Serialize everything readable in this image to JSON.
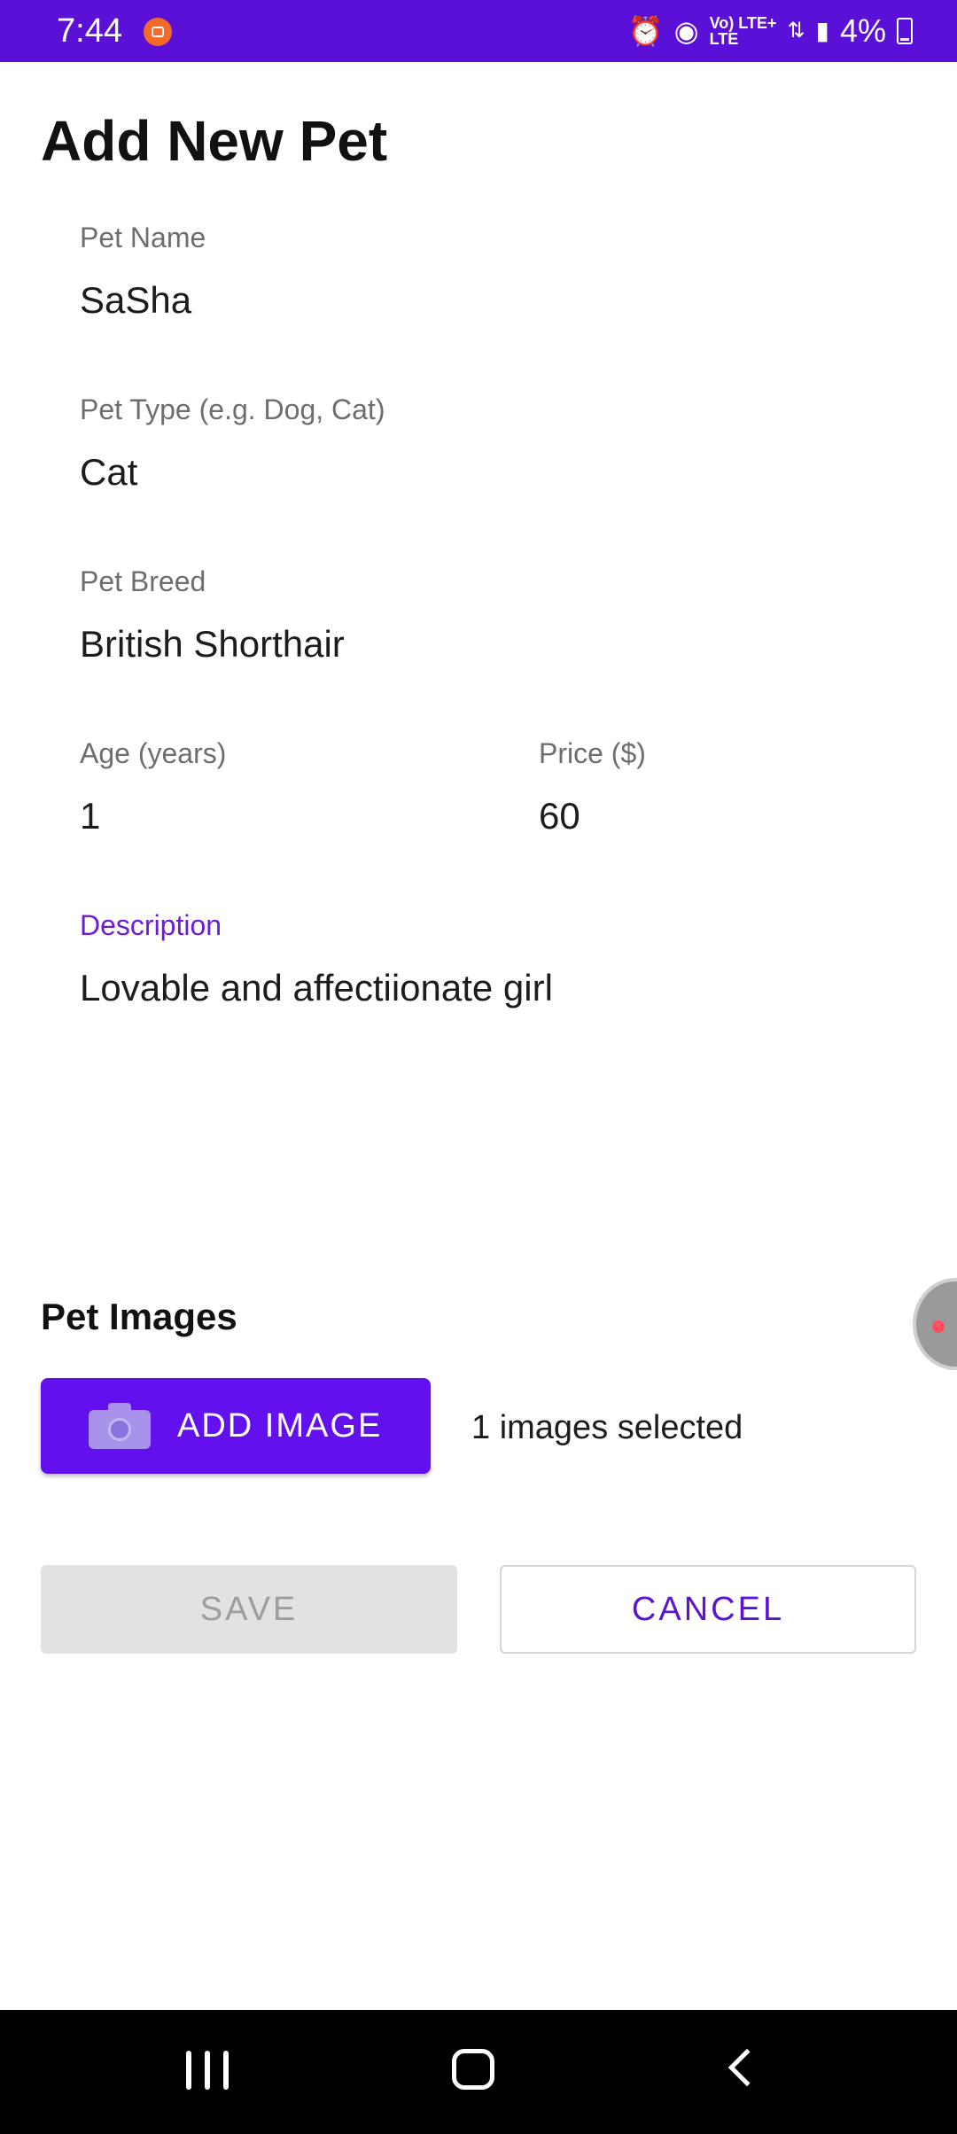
{
  "status_bar": {
    "time": "7:44",
    "network_label": "Vo) LTE+\nLTE",
    "battery": "4%",
    "accent_color": "#5b10d8"
  },
  "page": {
    "title": "Add New Pet"
  },
  "form": {
    "pet_name": {
      "label": "Pet Name",
      "value": "SaSha"
    },
    "pet_type": {
      "label": "Pet Type (e.g. Dog, Cat)",
      "value": "Cat"
    },
    "pet_breed": {
      "label": "Pet Breed",
      "value": "British Shorthair"
    },
    "age": {
      "label": "Age (years)",
      "value": "1"
    },
    "price": {
      "label": "Price ($)",
      "value": "60"
    },
    "description": {
      "label": "Description",
      "value": "Lovable and affectiionate girl",
      "focused": true
    }
  },
  "images": {
    "section_title": "Pet Images",
    "add_button_label": "ADD IMAGE",
    "selected_text": "1 images selected",
    "add_icon": "camera-icon"
  },
  "actions": {
    "save_label": "SAVE",
    "save_enabled": false,
    "cancel_label": "CANCEL"
  },
  "colors": {
    "primary": "#6210ee",
    "focused_label": "#6a1fd6",
    "cancel_text": "#5a14d2",
    "disabled_bg": "#e2e2e2"
  },
  "nav_bar": {
    "icons": [
      "recents-icon",
      "home-icon",
      "back-icon"
    ]
  }
}
